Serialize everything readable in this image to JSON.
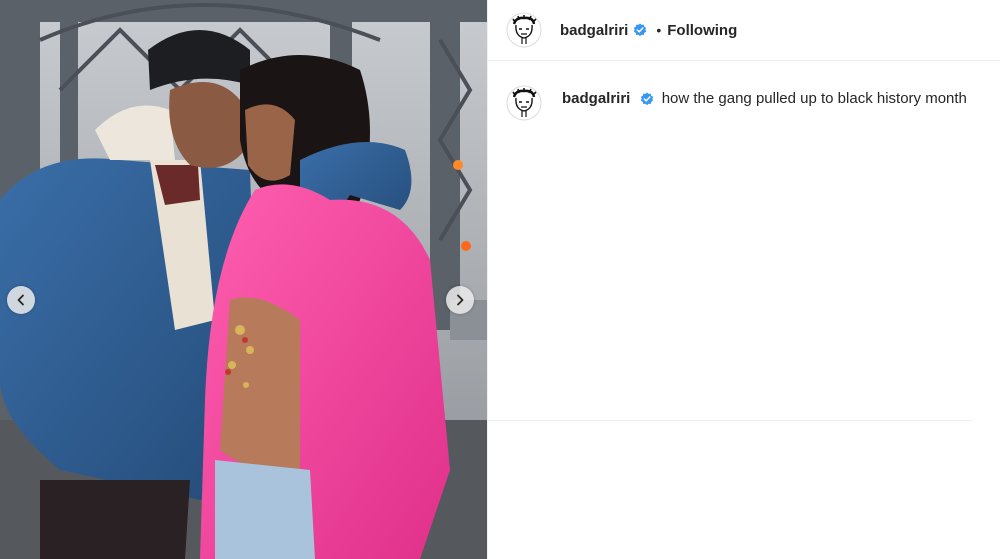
{
  "post": {
    "username": "badgalriri",
    "separator": "•",
    "follow_status": "Following",
    "caption_username": "badgalriri",
    "caption_text": "how the gang pulled up to black history month"
  },
  "colors": {
    "verified_badge": "#3897f0",
    "text": "#262626",
    "jacket_pink": "#ff4fa3",
    "denim_blue": "#2f5f94"
  },
  "icons": {
    "prev": "chevron-left-icon",
    "next": "chevron-right-icon",
    "verified": "verified-badge-icon"
  }
}
